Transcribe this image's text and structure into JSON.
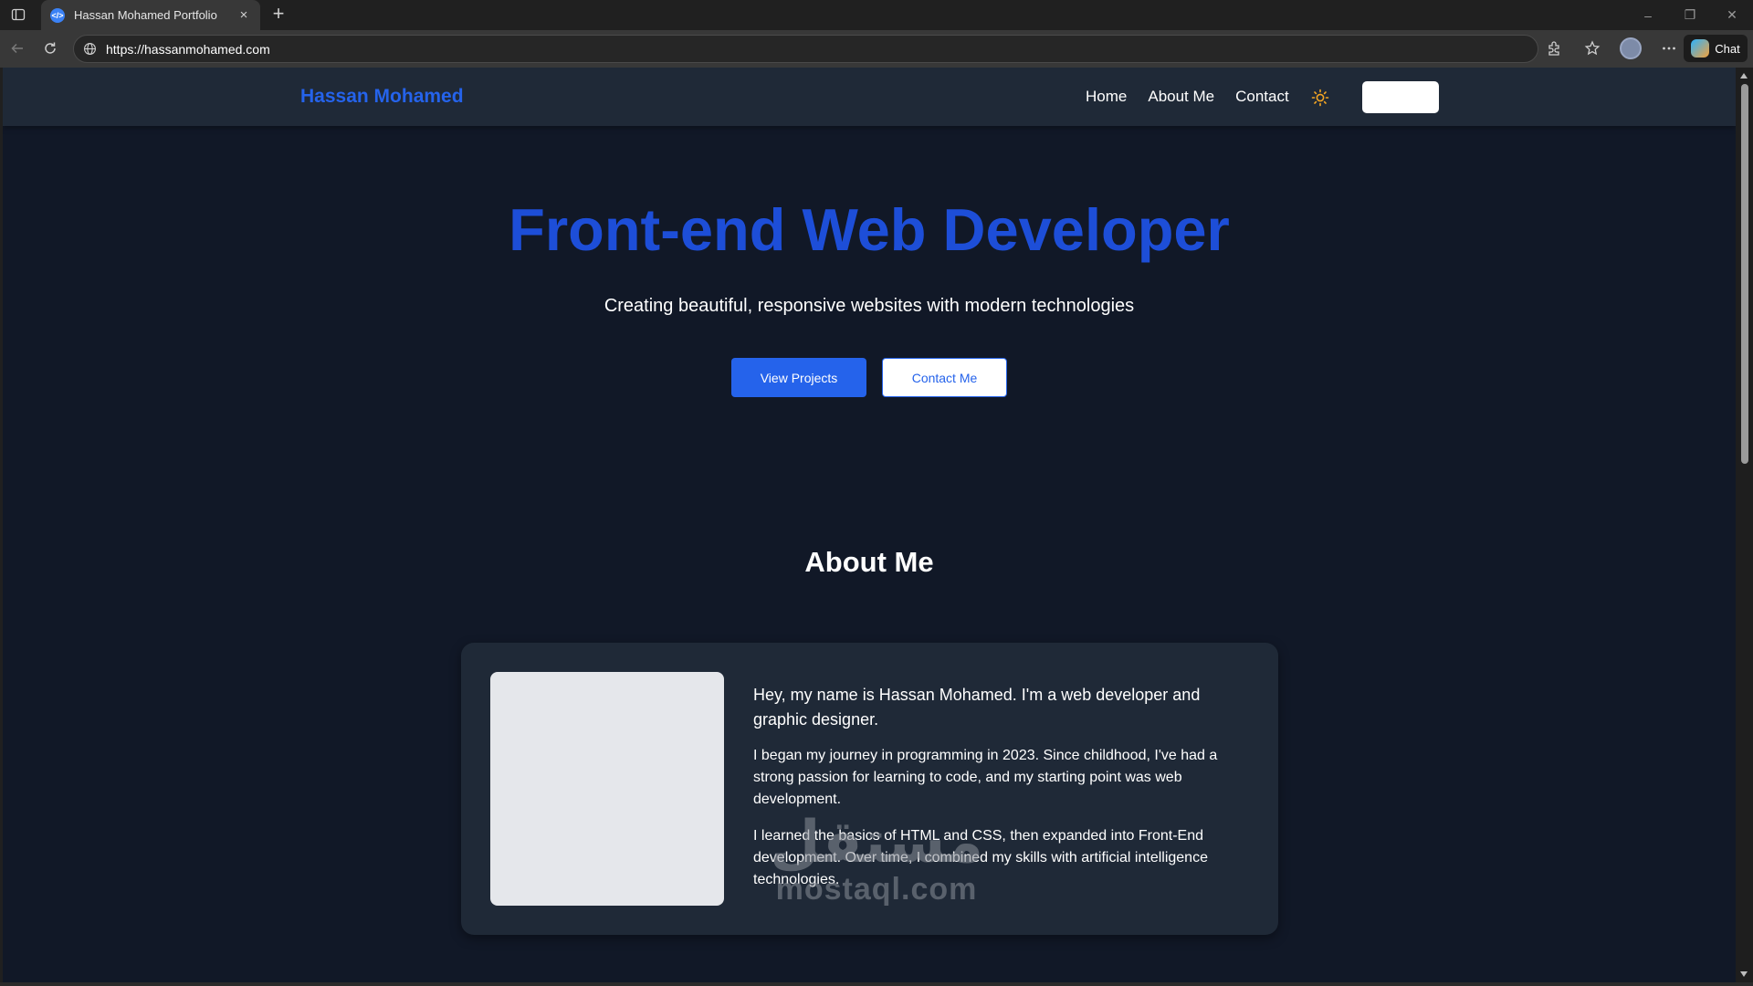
{
  "browser": {
    "tab_title": "Hassan Mohamed Portfolio",
    "tab_close": "×",
    "new_tab": "+",
    "url": "https://hassanmohamed.com",
    "chat_label": "Chat",
    "window_controls": {
      "minimize": "–",
      "restore": "❐",
      "close": "✕"
    }
  },
  "site": {
    "logo": "Hassan Mohamed",
    "nav": {
      "home": "Home",
      "about": "About Me",
      "contact": "Contact"
    }
  },
  "hero": {
    "title": "Front-end Web Developer",
    "subtitle": "Creating beautiful, responsive websites with modern technologies",
    "primary_button": "View Projects",
    "secondary_button": "Contact Me"
  },
  "about": {
    "title": "About Me",
    "lead": "Hey, my name is Hassan Mohamed. I'm a web developer and graphic designer.",
    "paragraph_1": "I began my journey in programming in 2023. Since childhood, I've had a strong passion for learning to code, and my starting point was web development.",
    "paragraph_2": "I learned the basics of HTML and CSS, then expanded into Front-End development. Over time, I combined my skills with artificial intelligence technologies."
  },
  "watermark": {
    "arabic": "مستقل",
    "latin": "mostaql.com"
  },
  "colors": {
    "accent": "#2563eb",
    "hero_title": "#1d4ed8",
    "page_bg": "#111827",
    "card_bg": "#1f2937",
    "theme_icon": "#f5a623"
  }
}
